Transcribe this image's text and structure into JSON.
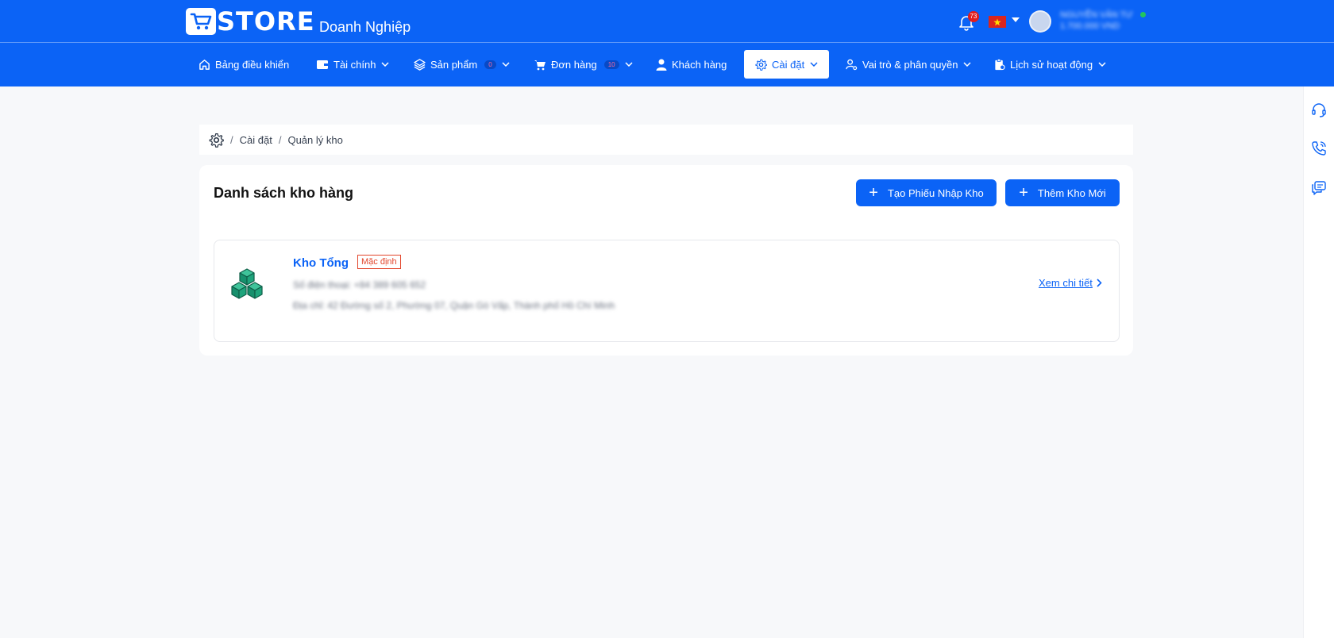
{
  "header": {
    "logo_text": "STORE",
    "logo_subtitle": "Doanh Nghiệp",
    "notification_count": "73",
    "user_name": "NGUYỄN VĂN TƯ",
    "user_balance": "1.700.000 VND"
  },
  "nav": {
    "items": [
      {
        "label": "Bảng điều khiển",
        "icon": "home-icon"
      },
      {
        "label": "Tài chính",
        "icon": "wallet-icon"
      },
      {
        "label": "Sản phẩm",
        "icon": "layers-icon",
        "badge": "0"
      },
      {
        "label": "Đơn hàng",
        "icon": "cart-icon",
        "badge": "10"
      },
      {
        "label": "Khách hàng",
        "icon": "user-icon"
      },
      {
        "label": "Cài đặt",
        "icon": "gear-icon",
        "active": true
      },
      {
        "label": "Vai trò & phân quyền",
        "icon": "user-key-icon"
      },
      {
        "label": "Lịch sử hoạt động",
        "icon": "clipboard-clock-icon"
      }
    ]
  },
  "breadcrumb": {
    "items": [
      "Cài đặt",
      "Quản lý kho"
    ]
  },
  "page": {
    "title": "Danh sách kho hàng",
    "btn_import": "Tạo Phiếu Nhập Kho",
    "btn_add": "Thêm Kho Mới"
  },
  "warehouse": {
    "name": "Kho Tổng",
    "badge": "Mặc định",
    "phone": "Số điện thoại: +84 389 605 652",
    "address": "Địa chỉ: 42 Đường số 2, Phường 07, Quận Gò Vấp, Thành phố Hồ Chí Minh",
    "detail_link": "Xem chi tiết"
  },
  "rail": {
    "icons": [
      "headset-icon",
      "phone-call-icon",
      "chat-icon"
    ]
  },
  "colors": {
    "primary": "#0b63f6",
    "badge_red": "#e2452b",
    "warehouse_icon": "#17906d"
  }
}
